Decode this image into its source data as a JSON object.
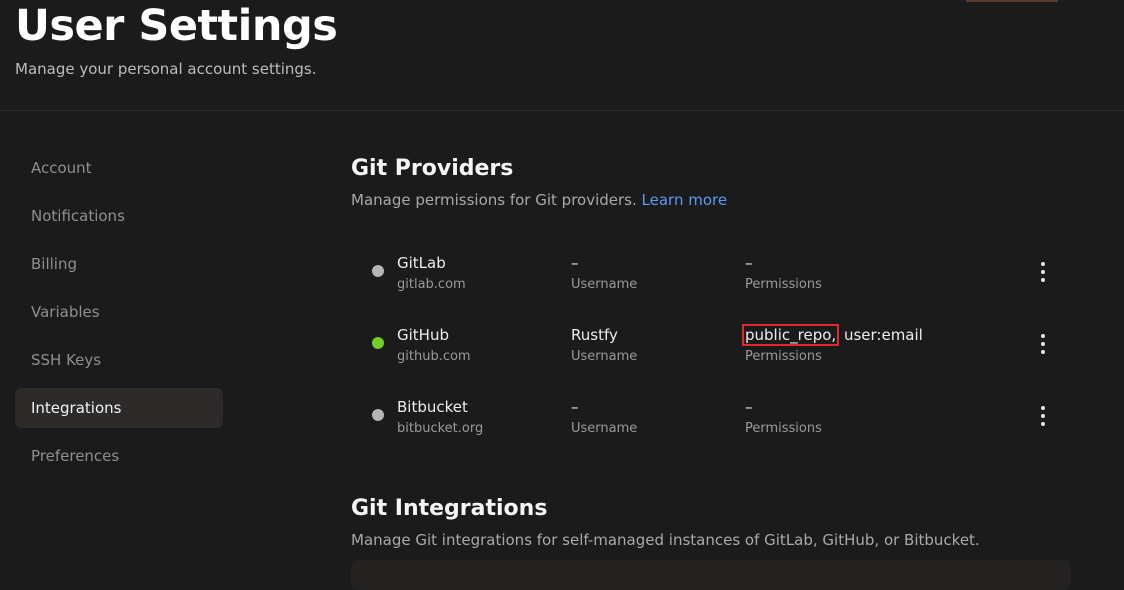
{
  "header": {
    "title": "User Settings",
    "subtitle": "Manage your personal account settings."
  },
  "sidebar": {
    "items": [
      {
        "label": "Account",
        "active": false
      },
      {
        "label": "Notifications",
        "active": false
      },
      {
        "label": "Billing",
        "active": false
      },
      {
        "label": "Variables",
        "active": false
      },
      {
        "label": "SSH Keys",
        "active": false
      },
      {
        "label": "Integrations",
        "active": true
      },
      {
        "label": "Preferences",
        "active": false
      }
    ]
  },
  "git_providers": {
    "title": "Git Providers",
    "description": "Manage permissions for Git providers.",
    "learn_more": "Learn more",
    "rows": [
      {
        "name": "GitLab",
        "domain": "gitlab.com",
        "status_color": "#b4b4b4",
        "username": "–",
        "username_label": "Username",
        "permissions_highlighted": "",
        "permissions": "–",
        "permissions_label": "Permissions"
      },
      {
        "name": "GitHub",
        "domain": "github.com",
        "status_color": "#6fcf2a",
        "username": "Rustfy",
        "username_label": "Username",
        "permissions_highlighted": "public_repo,",
        "permissions": "user:email",
        "permissions_label": "Permissions"
      },
      {
        "name": "Bitbucket",
        "domain": "bitbucket.org",
        "status_color": "#b4b4b4",
        "username": "–",
        "username_label": "Username",
        "permissions_highlighted": "",
        "permissions": "–",
        "permissions_label": "Permissions"
      }
    ]
  },
  "git_integrations": {
    "title": "Git Integrations",
    "description": "Manage Git integrations for self-managed instances of GitLab, GitHub, or Bitbucket."
  },
  "colors": {
    "background": "#1b1b1b",
    "accent_link": "#5a9cf0",
    "highlight_box": "#e0282e",
    "connected": "#6fcf2a",
    "disconnected": "#b4b4b4"
  }
}
